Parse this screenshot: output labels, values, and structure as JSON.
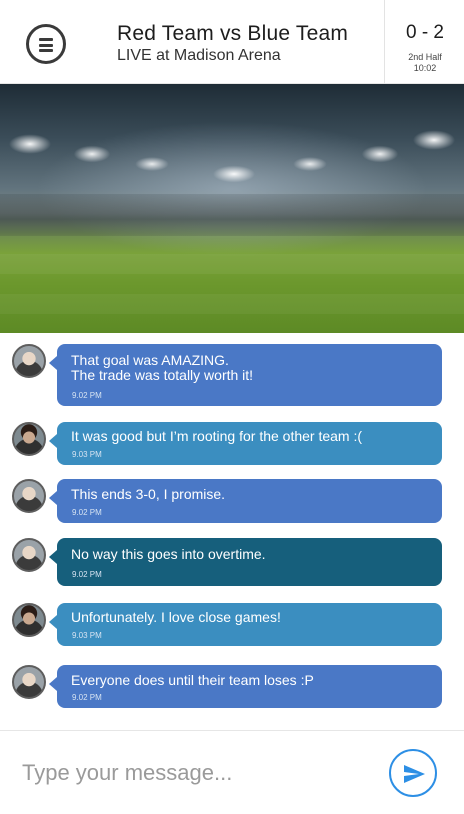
{
  "header": {
    "title": "Red Team vs Blue Team",
    "subtitle": "LIVE at Madison Arena",
    "score": "0 - 2",
    "period": "2nd Half",
    "clock": "10:02",
    "menu_icon": "menu-icon"
  },
  "banner": {
    "image": "stadium-lights-image"
  },
  "messages": [
    {
      "text": "That goal was AMAZING.\nThe trade was totally worth it!",
      "time": "9.02 PM",
      "color": "#4a78c6"
    },
    {
      "text": "It was good but I’m rooting for the other team :(",
      "time": "9.03 PM",
      "color": "#3b8ec0"
    },
    {
      "text": "This ends 3-0, I promise.",
      "time": "9.02 PM",
      "color": "#4a78c6"
    },
    {
      "text": "No way this goes into overtime.",
      "time": "9.02 PM",
      "color": "#165f7c"
    },
    {
      "text": "Unfortunately.  I love close games!",
      "time": "9.03 PM",
      "color": "#3b8ec0"
    },
    {
      "text": "Everyone does until their team loses :P",
      "time": "9.02 PM",
      "color": "#4a78c6"
    }
  ],
  "composer": {
    "placeholder": "Type your message...",
    "value": "",
    "send_icon": "send-icon",
    "accent": "#2d8fe5"
  }
}
